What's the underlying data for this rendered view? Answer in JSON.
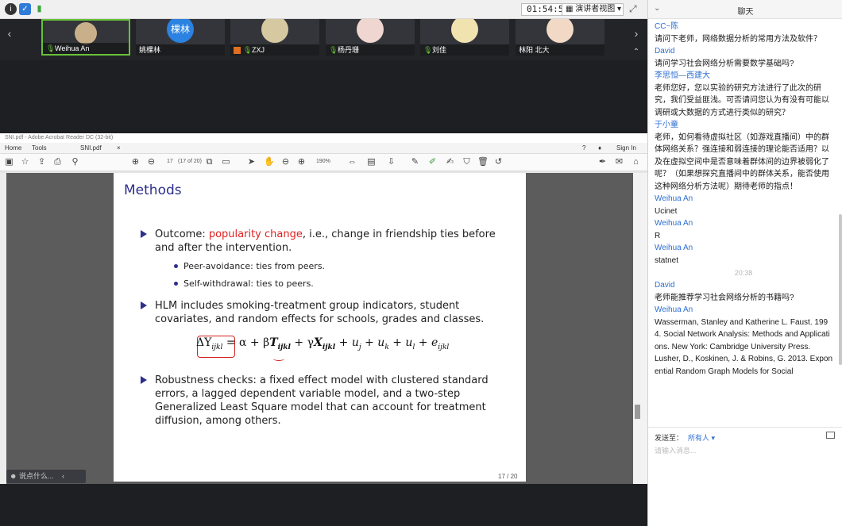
{
  "topbar": {
    "timer": "01:54:53",
    "view_mode": "演讲者视图",
    "view_caret": "▾"
  },
  "participants": [
    {
      "name": "Weihua An",
      "active": true
    },
    {
      "name": "姚棵林",
      "avatar_text": "棵林"
    },
    {
      "name": "ZXJ"
    },
    {
      "name": "杨丹珊"
    },
    {
      "name": "刘佳"
    },
    {
      "name": "林阳 北大"
    }
  ],
  "acrobat": {
    "title": "SNI.pdf - Adobe Acrobat Reader DC (32-bit)",
    "menu_home": "Home",
    "menu_tools": "Tools",
    "tab_file": "SNI.pdf",
    "tab_close": "×",
    "sign_in": "Sign In",
    "page_current": "17",
    "page_of": "(17 of 20)",
    "zoom": "190%"
  },
  "slide": {
    "title": "Methods",
    "bullet1_pre": "Outcome: ",
    "bullet1_red": "popularity change",
    "bullet1_post": ", i.e., change in friendship ties before and after the intervention.",
    "sub1": "Peer-avoidance:  ties from peers.",
    "sub2": "Self-withdrawal:  ties to peers.",
    "bullet2": "HLM includes smoking-treatment group indicators, student covariates, and random effects for schools, grades and classes.",
    "bullet3": "Robustness checks:  a fixed effect model with clustered standard errors, a lagged dependent variable model, and a two-step Generalized Least Square model that can account for treatment diffusion, among others.",
    "page_label": "17 / 20"
  },
  "float_chat": {
    "placeholder": "说点什么..."
  },
  "chat": {
    "title": "聊天",
    "messages": [
      {
        "name": "CC~陈",
        "text": "请问下老师，网络数据分析的常用方法及软件？"
      },
      {
        "name": "David",
        "text": "请问学习社会网络分析需要数学基础吗?"
      },
      {
        "name": "李思恒—西建大",
        "text": "老师您好，您以实验的研究方法进行了此次的研究，我们受益匪浅。可否请问您认为有没有可能以调研或大数据的方式进行类似的研究？"
      },
      {
        "name": "于小童",
        "text": "老师，如何看待虚拟社区（如游戏直播间）中的群体网络关系？强连接和弱连接的理论能否适用？以及在虚拟空间中是否意味着群体间的边界被弱化了呢？（如果想探究直播间中的群体关系，能否使用这种网络分析方法呢）期待老师的指点！"
      },
      {
        "name": "Weihua An",
        "text": "Ucinet"
      },
      {
        "name": "Weihua An",
        "text": "R"
      },
      {
        "name": "Weihua An",
        "text": "statnet"
      },
      {
        "time": "20:38"
      },
      {
        "name": "David",
        "text": "老师能推荐学习社会网络分析的书籍吗?"
      },
      {
        "name": "Weihua An",
        "text": "Wasserman, Stanley and Katherine L. Faust. 1994. Social Network Analysis: Methods and Applications. New York: Cambridge University Press.\nLusher, D., Koskinen, J. & Robins, G. 2013. Exponential Random Graph Models for Social"
      }
    ],
    "send_to_label": "发送至：",
    "send_to_value": "所有人 ▾",
    "input_placeholder": "请输入消息..."
  }
}
